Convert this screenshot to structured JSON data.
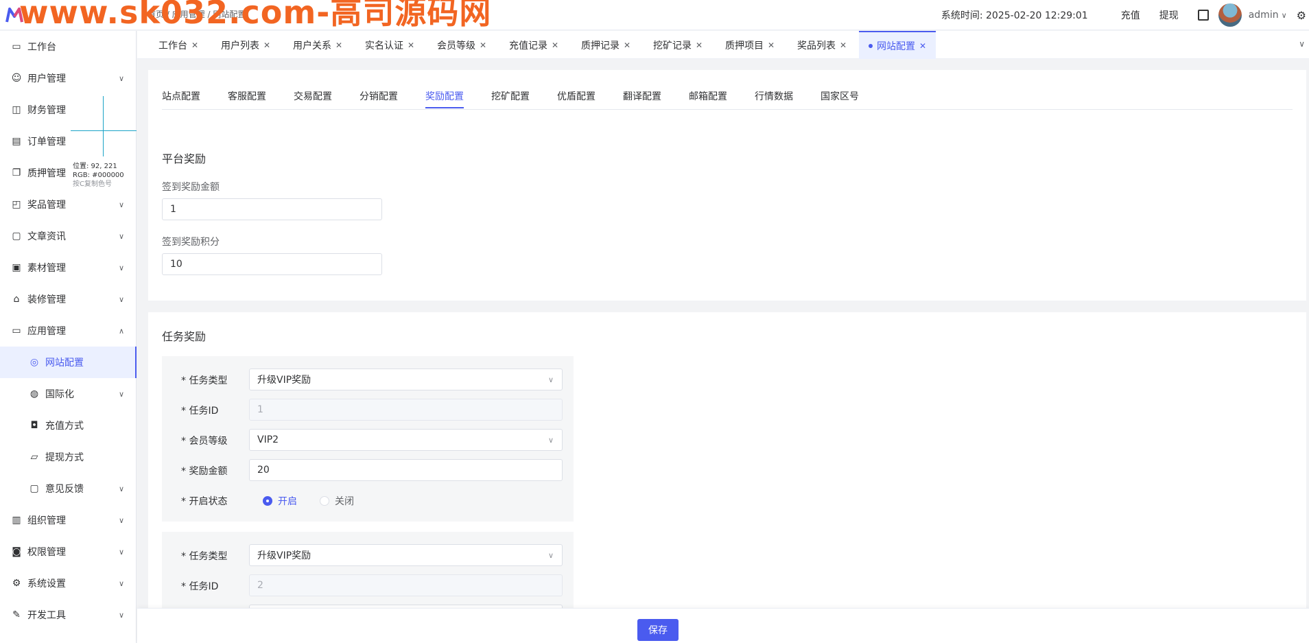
{
  "header": {
    "watermark": "www.sk032.com-高司源码网",
    "breadcrumb": "首页 / 应用管理 / 网站配置",
    "system_time_label": "系统时间: 2025-02-20 12:29:01",
    "recharge": "充值",
    "withdraw": "提现",
    "username": "admin"
  },
  "sidebar": {
    "items": [
      {
        "label": "工作台",
        "icon": "monitor-icon"
      },
      {
        "label": "用户管理",
        "icon": "user-icon"
      },
      {
        "label": "财务管理",
        "icon": "chart-icon"
      },
      {
        "label": "订单管理",
        "icon": "document-icon"
      },
      {
        "label": "质押管理",
        "icon": "copy-icon"
      },
      {
        "label": "奖品管理",
        "icon": "bag-icon"
      },
      {
        "label": "文章资讯",
        "icon": "message-icon"
      },
      {
        "label": "素材管理",
        "icon": "picture-icon"
      },
      {
        "label": "装修管理",
        "icon": "brush-icon"
      },
      {
        "label": "应用管理",
        "icon": "app-icon"
      },
      {
        "label": "网站配置",
        "icon": "globe-icon"
      },
      {
        "label": "国际化",
        "icon": "world-icon"
      },
      {
        "label": "充值方式",
        "icon": "wallet-icon"
      },
      {
        "label": "提现方式",
        "icon": "folder-icon"
      },
      {
        "label": "意见反馈",
        "icon": "feedback-icon"
      },
      {
        "label": "组织管理",
        "icon": "office-icon"
      },
      {
        "label": "权限管理",
        "icon": "lock-icon"
      },
      {
        "label": "系统设置",
        "icon": "gear-icon"
      },
      {
        "label": "开发工具",
        "icon": "pen-icon"
      }
    ]
  },
  "overlay": {
    "position": "位置: 92, 221",
    "rgb": "RGB: #000000",
    "hint": "按C复制色号"
  },
  "tabs": [
    "工作台",
    "用户列表",
    "用户关系",
    "实名认证",
    "会员等级",
    "充值记录",
    "质押记录",
    "挖矿记录",
    "质押项目",
    "奖品列表",
    "网站配置"
  ],
  "subtabs": [
    "站点配置",
    "客服配置",
    "交易配置",
    "分销配置",
    "奖励配置",
    "挖矿配置",
    "优盾配置",
    "翻译配置",
    "邮箱配置",
    "行情数据",
    "国家区号"
  ],
  "platform": {
    "title": "平台奖励",
    "signin_amount_label": "签到奖励金额",
    "signin_amount_value": "1",
    "signin_points_label": "签到奖励积分",
    "signin_points_value": "10"
  },
  "task": {
    "title": "任务奖励",
    "labels": {
      "type": "* 任务类型",
      "id": "* 任务ID",
      "level": "* 会员等级",
      "amount": "* 奖励金额",
      "status": "* 开启状态"
    },
    "radio_on": "开启",
    "radio_off": "关闭",
    "items": [
      {
        "type": "升级VIP奖励",
        "id": "1",
        "level": "VIP2",
        "amount": "20",
        "status": "开启"
      },
      {
        "type": "升级VIP奖励",
        "id": "2"
      }
    ]
  },
  "footer": {
    "save": "保存"
  },
  "colors": {
    "accent": "#4a5bef",
    "watermark": "#f26522"
  }
}
